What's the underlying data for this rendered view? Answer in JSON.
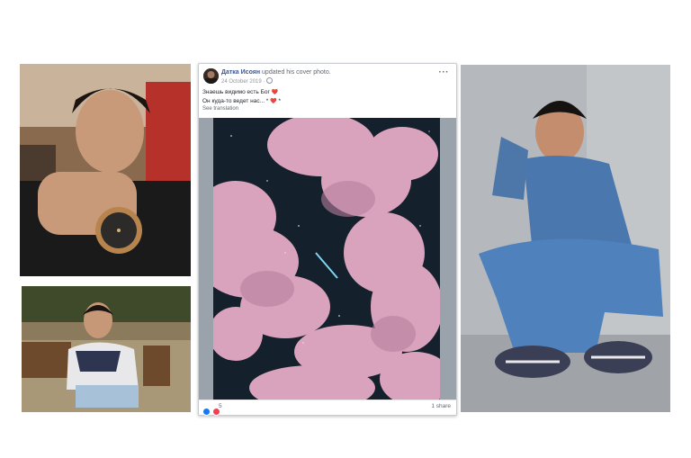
{
  "post": {
    "author": "Датка Исоян",
    "action": "updated his cover photo.",
    "date": "24 October 2019 ·",
    "more_label": "···",
    "text_line_1": "Знаешь видимо есть Бог",
    "text_line_2": "Он куда-то ведет нас... *",
    "heart_glyph": "❤️",
    "star_glyph": "*",
    "see_translation": "See translation",
    "reaction_count": "5",
    "share_count": "1 share"
  },
  "icons": {
    "globe": "globe-icon",
    "more": "more-options-icon",
    "like": "like-reaction-icon",
    "love": "love-reaction-icon"
  },
  "colors": {
    "link": "#385898",
    "meta_text": "#606770",
    "sky_dark": "#14202b",
    "cloud_pink": "#d9a3bd",
    "like_blue": "#1877f2",
    "love_red": "#f33e58"
  }
}
